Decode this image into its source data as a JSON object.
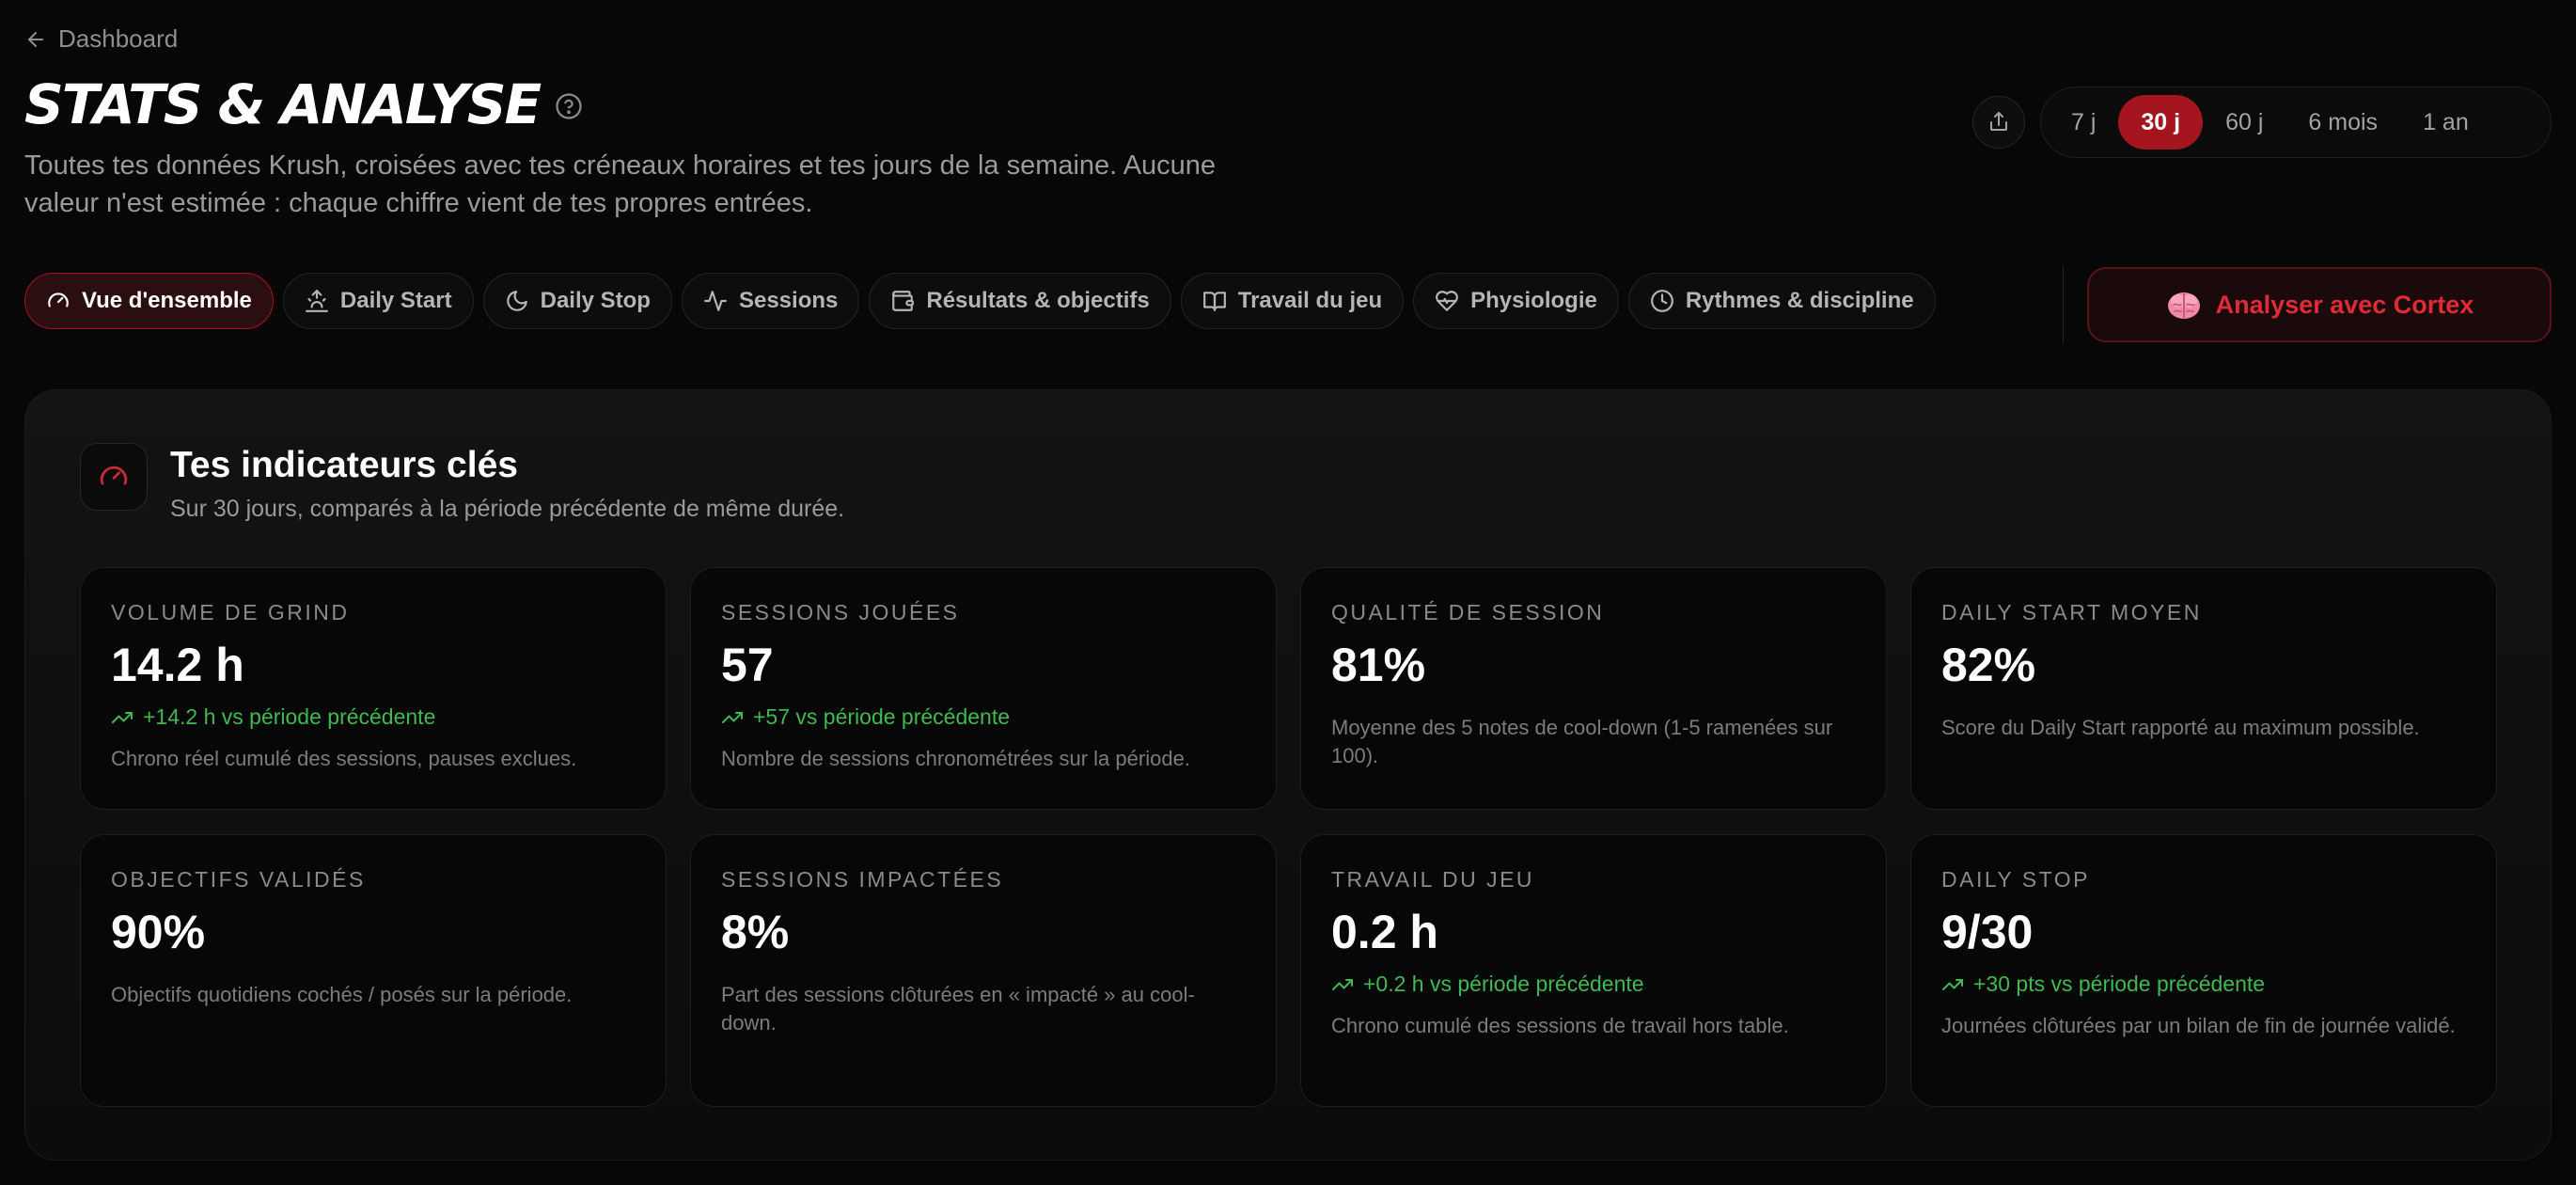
{
  "nav": {
    "back_label": "Dashboard"
  },
  "header": {
    "title": "STATS & ANALYSE",
    "subtitle": "Toutes tes données Krush, croisées avec tes créneaux horaires et tes jours de la semaine. Aucune valeur n'est estimée : chaque chiffre vient de tes propres entrées."
  },
  "period": {
    "options": [
      "7 j",
      "30 j",
      "60 j",
      "6 mois",
      "1 an"
    ],
    "selected": "30 j"
  },
  "tabs": [
    {
      "label": "Vue d'ensemble",
      "icon": "gauge-icon",
      "active": true
    },
    {
      "label": "Daily Start",
      "icon": "sunrise-icon"
    },
    {
      "label": "Daily Stop",
      "icon": "moon-icon"
    },
    {
      "label": "Sessions",
      "icon": "activity-icon"
    },
    {
      "label": "Résultats & objectifs",
      "icon": "wallet-icon"
    },
    {
      "label": "Travail du jeu",
      "icon": "book-icon"
    },
    {
      "label": "Physiologie",
      "icon": "heart-pulse-icon"
    },
    {
      "label": "Rythmes & discipline",
      "icon": "clock-icon"
    }
  ],
  "cortex": {
    "label": "Analyser avec Cortex",
    "icon": "brain-icon"
  },
  "panel": {
    "title": "Tes indicateurs clés",
    "subtitle": "Sur 30 jours, comparés à la période précédente de même durée.",
    "icon": "gauge-icon"
  },
  "cards": [
    {
      "label": "VOLUME DE GRIND",
      "value": "14.2 h",
      "delta": "+14.2 h vs période précédente",
      "desc": "Chrono réel cumulé des sessions, pauses exclues."
    },
    {
      "label": "SESSIONS JOUÉES",
      "value": "57",
      "delta": "+57 vs période précédente",
      "desc": "Nombre de sessions chronométrées sur la période."
    },
    {
      "label": "QUALITÉ DE SESSION",
      "value": "81%",
      "delta": "",
      "desc": "Moyenne des 5 notes de cool-down (1-5 ramenées sur 100)."
    },
    {
      "label": "DAILY START MOYEN",
      "value": "82%",
      "delta": "",
      "desc": "Score du Daily Start rapporté au maximum possible."
    },
    {
      "label": "OBJECTIFS VALIDÉS",
      "value": "90%",
      "delta": "",
      "desc": "Objectifs quotidiens cochés / posés sur la période."
    },
    {
      "label": "SESSIONS IMPACTÉES",
      "value": "8%",
      "delta": "",
      "desc": "Part des sessions clôturées en « impacté » au cool-down."
    },
    {
      "label": "TRAVAIL DU JEU",
      "value": "0.2 h",
      "delta": "+0.2 h vs période précédente",
      "desc": "Chrono cumulé des sessions de travail hors table."
    },
    {
      "label": "DAILY STOP",
      "value": "9/30",
      "delta": "+30 pts vs période précédente",
      "desc": "Journées clôturées par un bilan de fin de journée validé."
    }
  ],
  "colors": {
    "accent": "#a5151f",
    "positive": "#3fb950",
    "background": "#070707"
  }
}
